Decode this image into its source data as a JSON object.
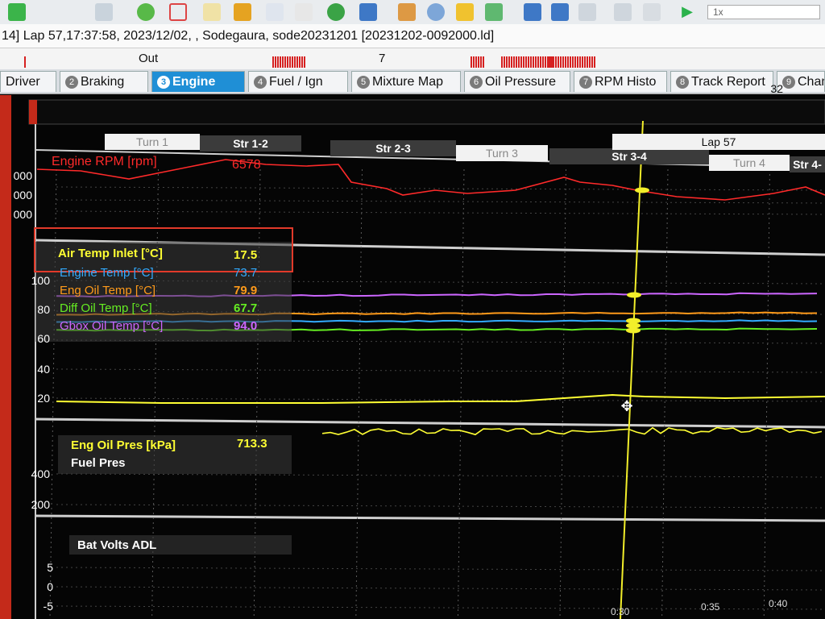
{
  "infobar": {
    "text": "14] Lap 57,17:37:58, 2023/12/02, , Sodegaura, sode20231201 [20231202-0092000.ld]"
  },
  "toolbar": {
    "speed": "1x"
  },
  "lapbar": {
    "out_label": "Out",
    "lap_number": "7"
  },
  "tabs": [
    {
      "num": "",
      "label": "Driver"
    },
    {
      "num": "2",
      "label": "Braking"
    },
    {
      "num": "3",
      "label": "Engine"
    },
    {
      "num": "4",
      "label": "Fuel / Ign"
    },
    {
      "num": "5",
      "label": "Mixture Map"
    },
    {
      "num": "6",
      "label": "Oil Pressure"
    },
    {
      "num": "7",
      "label": "RPM Histo"
    },
    {
      "num": "8",
      "label": "Track Report"
    },
    {
      "num": "9",
      "label": "Chann"
    }
  ],
  "tab_count": "32",
  "sectors": {
    "turn1": "Turn 1",
    "str12": "Str 1-2",
    "str23": "Str 2-3",
    "turn3": "Turn 3",
    "str34": "Str 3-4",
    "turn4": "Turn 4",
    "str4": "Str 4-",
    "lap": "Lap 57"
  },
  "channels": {
    "rpm": {
      "label": "Engine RPM [rpm]",
      "value": "6578",
      "color": "#ff2a2a"
    },
    "air_temp": {
      "label": "Air Temp Inlet [°C]",
      "value": "17.5",
      "color": "#ffff33"
    },
    "engine_temp": {
      "label": "Engine Temp [°C]",
      "value": "73.7",
      "color": "#33aaff"
    },
    "eng_oil_temp": {
      "label": "Eng Oil Temp [°C]",
      "value": "79.9",
      "color": "#ff9a1a"
    },
    "diff_oil_temp": {
      "label": "Diff Oil Temp [°C]",
      "value": "67.7",
      "color": "#66ee22"
    },
    "gbox_oil_temp": {
      "label": "Gbox Oil Temp [°C]",
      "value": "94.0",
      "color": "#cc66ff"
    },
    "eng_oil_pres": {
      "label": "Eng Oil Pres [kPa]",
      "value": "713.3",
      "color": "#ffff33"
    },
    "fuel_pres": {
      "label": "Fuel Pres",
      "color": "#ffffff"
    },
    "bat_volts": {
      "label": "Bat Volts ADL",
      "color": "#ffffff"
    }
  },
  "axes": {
    "rpm": [
      "000",
      "000",
      "000"
    ],
    "temp": [
      "100",
      "80",
      "60",
      "40",
      "20"
    ],
    "pres": [
      "400",
      "200"
    ],
    "volts": [
      "5",
      "0",
      "-5"
    ],
    "time": [
      "0:30",
      "0:35",
      "0:40"
    ]
  }
}
